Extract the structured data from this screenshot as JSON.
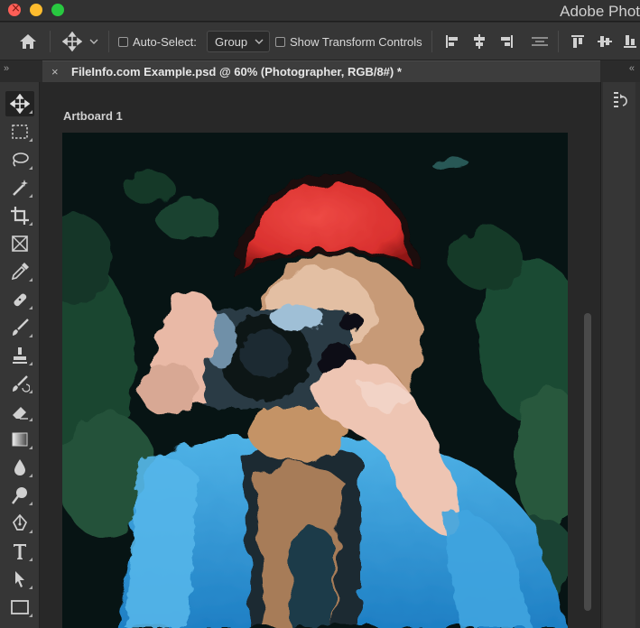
{
  "app": {
    "title": "Adobe Phot"
  },
  "options_bar": {
    "auto_select_label": "Auto-Select:",
    "auto_select_value": "Group",
    "show_transform_label": "Show Transform Controls",
    "icons": [
      "home-icon",
      "move-icon",
      "chevron-down-icon",
      "align-left-edges-icon",
      "align-horizontal-centers-icon",
      "align-right-edges-icon",
      "distribute-icon",
      "align-top-edges-icon",
      "align-vertical-centers-icon",
      "align-bottom-edges-icon"
    ]
  },
  "document": {
    "tab_title": "FileInfo.com Example.psd @ 60% (Photographer, RGB/8#) *",
    "artboard_label": "Artboard 1"
  },
  "tools": [
    "move-tool",
    "rectangular-marquee-tool",
    "lasso-tool",
    "magic-wand-tool",
    "crop-tool",
    "frame-tool",
    "eyedropper-tool",
    "healing-brush-tool",
    "brush-tool",
    "clone-stamp-tool",
    "history-brush-tool",
    "eraser-tool",
    "gradient-tool",
    "blur-tool",
    "dodge-tool",
    "pen-tool",
    "type-tool",
    "path-selection-tool",
    "rectangle-tool"
  ],
  "colors": {
    "hat": "#d9302e",
    "background": "#0a1a1b",
    "foliage": "#1f4e35",
    "jacket": "#2e8fd0",
    "skin": "#e9b9a6"
  }
}
